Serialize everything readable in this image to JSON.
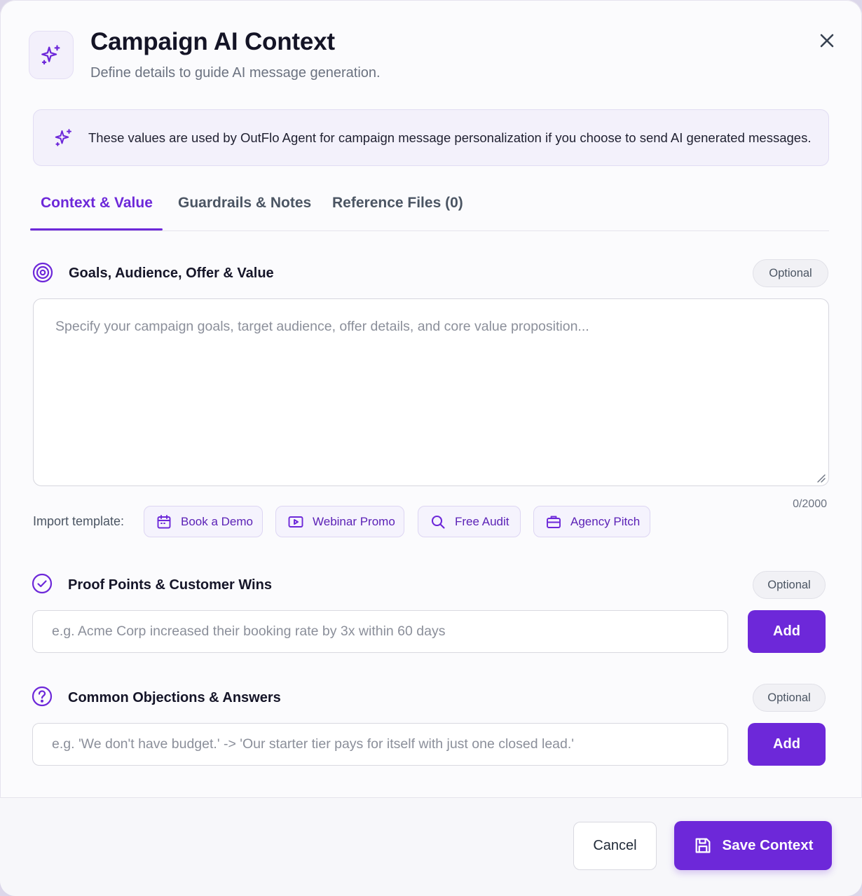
{
  "header": {
    "title": "Campaign AI Context",
    "subtitle": "Define details to guide AI message generation."
  },
  "banner": {
    "text": "These values are used by OutFlo Agent for campaign message personalization if you choose to send AI generated messages."
  },
  "tabs": [
    {
      "label": "Context & Value",
      "active": true
    },
    {
      "label": "Guardrails & Notes",
      "active": false
    },
    {
      "label": "Reference Files (0)",
      "active": false
    }
  ],
  "goals": {
    "title": "Goals, Audience, Offer & Value",
    "badge": "Optional",
    "placeholder": "Specify your campaign goals, target audience, offer details, and core value proposition...",
    "value": "",
    "counter": "0/2000"
  },
  "templates": {
    "label": "Import template:",
    "items": [
      {
        "label": "Book a Demo",
        "icon": "calendar-icon"
      },
      {
        "label": "Webinar Promo",
        "icon": "play-icon"
      },
      {
        "label": "Free Audit",
        "icon": "search-icon"
      },
      {
        "label": "Agency Pitch",
        "icon": "briefcase-icon"
      }
    ]
  },
  "proof": {
    "title": "Proof Points & Customer Wins",
    "badge": "Optional",
    "placeholder": "e.g. Acme Corp increased their booking rate by 3x within 60 days",
    "add_label": "Add"
  },
  "objections": {
    "title": "Common Objections & Answers",
    "badge": "Optional",
    "placeholder": "e.g. 'We don't have budget.' -> 'Our starter tier pays for itself with just one closed lead.'",
    "add_label": "Add"
  },
  "footer": {
    "cancel_label": "Cancel",
    "save_label": "Save Context"
  },
  "colors": {
    "accent": "#6d28d9",
    "banner_bg": "#f3f1fb"
  }
}
